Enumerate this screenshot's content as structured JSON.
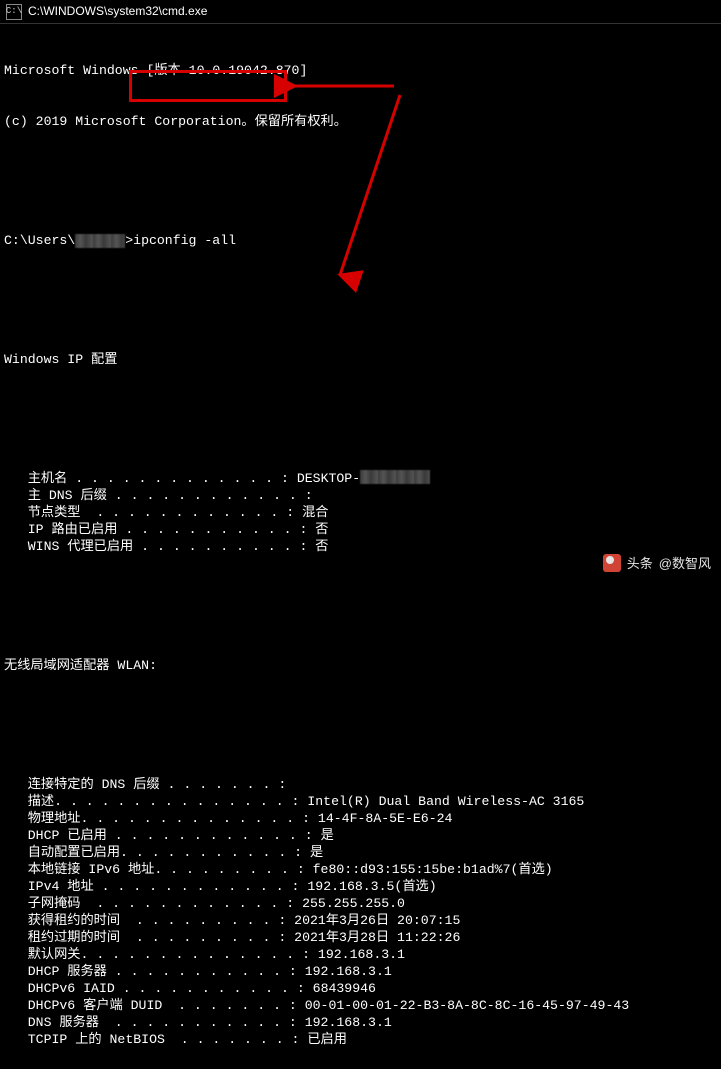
{
  "window": {
    "title": "C:\\WINDOWS\\system32\\cmd.exe"
  },
  "header": {
    "line1": "Microsoft Windows [版本 10.0.19042.870]",
    "line2": "(c) 2019 Microsoft Corporation。保留所有权利。"
  },
  "prompt": {
    "prefix": "C:\\Users\\",
    "command": "ipconfig -all",
    "caret": ">"
  },
  "sections": {
    "ipconfig_title": "Windows IP 配置",
    "host": {
      "items": [
        {
          "label": "   主机名",
          "dots": " . . . . . . . . . . . . . ",
          "value": "DESKTOP-"
        },
        {
          "label": "   主 DNS 后缀",
          "dots": " . . . . . . . . . . . . ",
          "value": ""
        },
        {
          "label": "   节点类型",
          "dots": "  . . . . . . . . . . . . ",
          "value": "混合"
        },
        {
          "label": "   IP 路由已启用",
          "dots": " . . . . . . . . . . . ",
          "value": "否"
        },
        {
          "label": "   WINS 代理已启用",
          "dots": " . . . . . . . . . . ",
          "value": "否"
        }
      ]
    },
    "wlan_title": "无线局域网适配器 WLAN:",
    "wlan": {
      "items": [
        {
          "label": "   连接特定的 DNS 后缀",
          "dots": " . . . . . . . ",
          "value": ""
        },
        {
          "label": "   描述.",
          "dots": " . . . . . . . . . . . . . . ",
          "value": "Intel(R) Dual Band Wireless-AC 3165"
        },
        {
          "label": "   物理地址.",
          "dots": " . . . . . . . . . . . . . ",
          "value": "14-4F-8A-5E-E6-24"
        },
        {
          "label": "   DHCP 已启用",
          "dots": " . . . . . . . . . . . . ",
          "value": "是"
        },
        {
          "label": "   自动配置已启用.",
          "dots": " . . . . . . . . . . ",
          "value": "是"
        },
        {
          "label": "   本地链接 IPv6 地址.",
          "dots": " . . . . . . . . ",
          "value": "fe80::d93:155:15be:b1ad%7(首选)"
        },
        {
          "label": "   IPv4 地址",
          "dots": " . . . . . . . . . . . . ",
          "value": "192.168.3.5(首选)"
        },
        {
          "label": "   子网掩码",
          "dots": "  . . . . . . . . . . . . ",
          "value": "255.255.255.0"
        },
        {
          "label": "   获得租约的时间",
          "dots": "  . . . . . . . . . ",
          "value": "2021年3月26日 20:07:15"
        },
        {
          "label": "   租约过期的时间",
          "dots": "  . . . . . . . . . ",
          "value": "2021年3月28日 11:22:26"
        },
        {
          "label": "   默认网关.",
          "dots": " . . . . . . . . . . . . . ",
          "value": "192.168.3.1"
        },
        {
          "label": "   DHCP 服务器",
          "dots": " . . . . . . . . . . . ",
          "value": "192.168.3.1"
        },
        {
          "label": "   DHCPv6 IAID",
          "dots": " . . . . . . . . . . . ",
          "value": "68439946"
        },
        {
          "label": "   DHCPv6 客户端 DUID",
          "dots": "  . . . . . . . ",
          "value": "00-01-00-01-22-B3-8A-8C-8C-16-45-97-49-43"
        },
        {
          "label": "   DNS 服务器",
          "dots": "  . . . . . . . . . . . ",
          "value": "192.168.3.1"
        },
        {
          "label": "   TCPIP 上的 NetBIOS",
          "dots": "  . . . . . . . ",
          "value": "已启用"
        }
      ]
    }
  },
  "watermark": {
    "prefix": "头条",
    "author": "@数智风"
  },
  "annotations": {
    "highlight": "command",
    "arrow1": "to-command-box",
    "arrow2": "to-wlan-section"
  }
}
